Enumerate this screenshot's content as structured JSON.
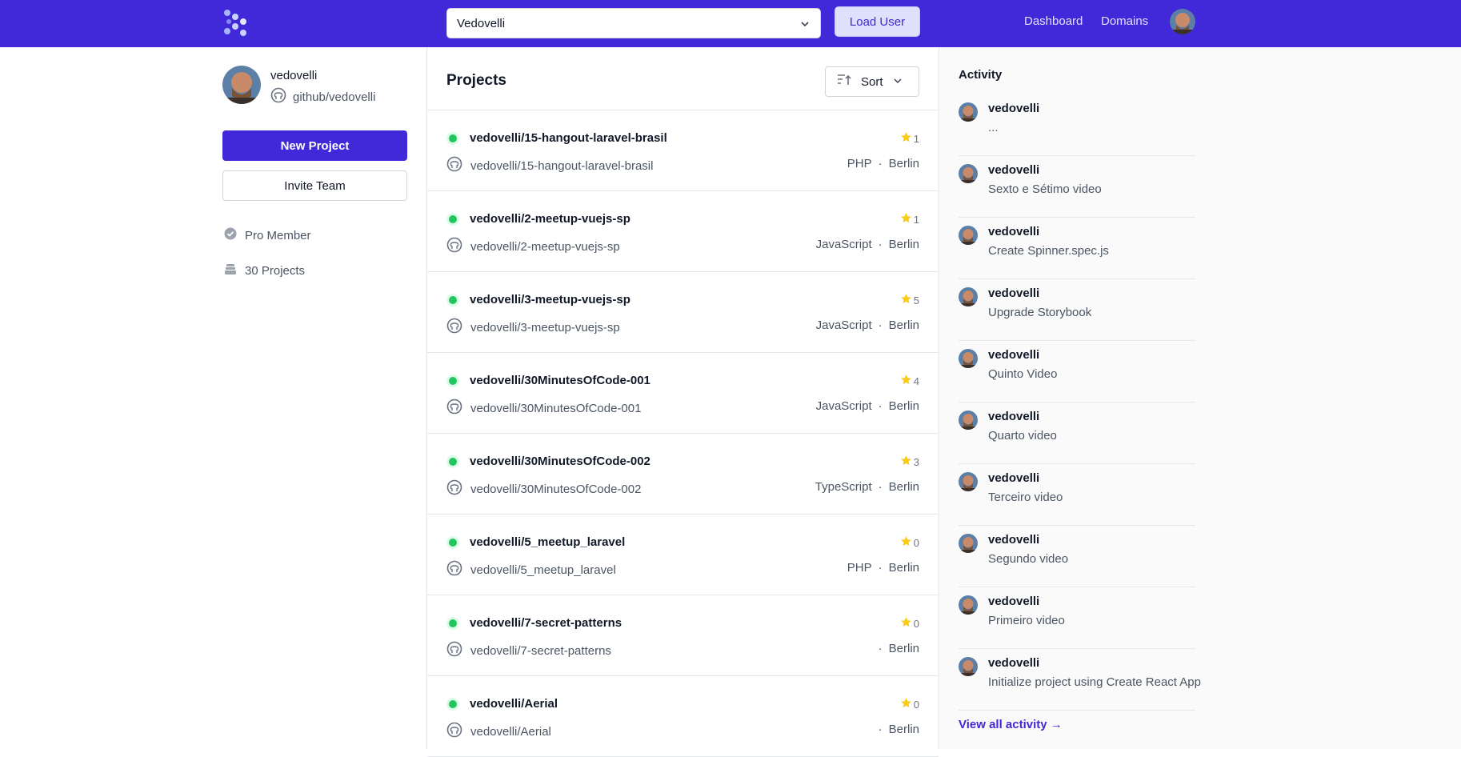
{
  "header": {
    "user_select_value": "Vedovelli",
    "load_user_label": "Load User",
    "nav": [
      "Dashboard",
      "Domains"
    ],
    "brand_color": "#4128d9"
  },
  "profile": {
    "username": "vedovelli",
    "github": "github/vedovelli",
    "new_project_label": "New Project",
    "invite_team_label": "Invite Team",
    "membership": "Pro Member",
    "projects_count": "30 Projects"
  },
  "projects": {
    "title": "Projects",
    "sort_label": "Sort",
    "separator": "·",
    "items": [
      {
        "name": "vedovelli/15-hangout-laravel-brasil",
        "repo": "vedovelli/15-hangout-laravel-brasil",
        "stars": "1",
        "language": "PHP",
        "location": "Berlin"
      },
      {
        "name": "vedovelli/2-meetup-vuejs-sp",
        "repo": "vedovelli/2-meetup-vuejs-sp",
        "stars": "1",
        "language": "JavaScript",
        "location": "Berlin"
      },
      {
        "name": "vedovelli/3-meetup-vuejs-sp",
        "repo": "vedovelli/3-meetup-vuejs-sp",
        "stars": "5",
        "language": "JavaScript",
        "location": "Berlin"
      },
      {
        "name": "vedovelli/30MinutesOfCode-001",
        "repo": "vedovelli/30MinutesOfCode-001",
        "stars": "4",
        "language": "JavaScript",
        "location": "Berlin"
      },
      {
        "name": "vedovelli/30MinutesOfCode-002",
        "repo": "vedovelli/30MinutesOfCode-002",
        "stars": "3",
        "language": "TypeScript",
        "location": "Berlin"
      },
      {
        "name": "vedovelli/5_meetup_laravel",
        "repo": "vedovelli/5_meetup_laravel",
        "stars": "0",
        "language": "PHP",
        "location": "Berlin"
      },
      {
        "name": "vedovelli/7-secret-patterns",
        "repo": "vedovelli/7-secret-patterns",
        "stars": "0",
        "language": "",
        "location": "Berlin"
      },
      {
        "name": "vedovelli/Aerial",
        "repo": "vedovelli/Aerial",
        "stars": "0",
        "language": "",
        "location": "Berlin"
      }
    ]
  },
  "activity": {
    "title": "Activity",
    "items": [
      {
        "user": "vedovelli",
        "text": "..."
      },
      {
        "user": "vedovelli",
        "text": "Sexto e Sétimo video"
      },
      {
        "user": "vedovelli",
        "text": "Create Spinner.spec.js"
      },
      {
        "user": "vedovelli",
        "text": "Upgrade Storybook"
      },
      {
        "user": "vedovelli",
        "text": "Quinto Video"
      },
      {
        "user": "vedovelli",
        "text": "Quarto video"
      },
      {
        "user": "vedovelli",
        "text": "Terceiro video"
      },
      {
        "user": "vedovelli",
        "text": "Segundo video"
      },
      {
        "user": "vedovelli",
        "text": "Primeiro video"
      },
      {
        "user": "vedovelli",
        "text": "Initialize project using Create React App"
      }
    ],
    "view_all_label": "View all activity →"
  }
}
